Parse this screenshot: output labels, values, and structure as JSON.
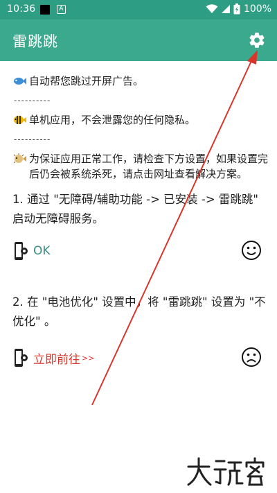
{
  "status_bar": {
    "time": "10:36",
    "notification_letter": "A",
    "battery": "100%"
  },
  "app_bar": {
    "title": "雷跳跳",
    "settings_icon": "gear-icon"
  },
  "notices": [
    {
      "icon": "fish-emoji",
      "text": "自动帮您跳过开屏广告。"
    },
    {
      "icon": "tropical-fish-emoji",
      "text": "单机应用，不会泄露您的任何隐私。"
    },
    {
      "icon": "blowfish-emoji",
      "text": "为保证应用正常工作，请检查下方设置，如果设置完后仍会被系统杀死，请点击网址查看解决方案。"
    }
  ],
  "dashes": "----------",
  "steps": [
    {
      "text": "1. 通过 \"无障碍/辅助功能 -> 已安装 -> 雷跳跳\" 启动无障碍服务。",
      "action_label": "OK",
      "status": "smiling-face-icon"
    },
    {
      "text": "2. 在 \"电池优化\" 设置中，将 \"雷跳跳\" 设置为 \"不优化\" 。",
      "action_label": "立即前往",
      "action_suffix": ">>",
      "status": "frowning-face-icon"
    }
  ],
  "colors": {
    "status_bar": "#2d9e83",
    "app_bar": "#3aa98d",
    "ok_link": "#3a8f82",
    "go_link": "#d9362b",
    "annotation_arrow": "#d9362b"
  }
}
